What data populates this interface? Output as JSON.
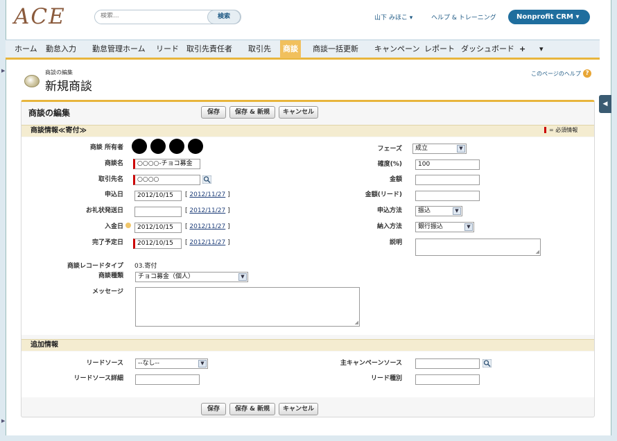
{
  "header": {
    "logo": "ACE",
    "search_placeholder": "検索...",
    "search_button": "検索",
    "user_menu": "山下 みほこ ▾",
    "help": "ヘルプ & トレーニング",
    "app_menu": "Nonprofit CRM ▾"
  },
  "tabs": [
    "ホーム",
    "勤怠入力",
    "勤怠管理ホーム",
    "リード",
    "取引先責任者",
    "取引先",
    "商談",
    "商談一括更新",
    "キャンペーン",
    "レポート",
    "ダッシュボード",
    "+",
    "▾"
  ],
  "active_tab": "商談",
  "page": {
    "subtitle": "商談の編集",
    "title": "新規商談",
    "help_link": "このページのヘルプ",
    "help_icon": "?"
  },
  "panel": {
    "title": "商談の編集",
    "save": "保存",
    "save_new": "保存 & 新規",
    "cancel": "キャンセル"
  },
  "section1": {
    "title": "商談情報≪寄付≫",
    "required_legend": "= 必須情報"
  },
  "left_fields": {
    "owner_label": "商談 所有者",
    "name_label": "商談名",
    "name_value": "○○○○-チョコ募金",
    "account_label": "取引先名",
    "account_value": "○○○○",
    "apply_date_label": "申込日",
    "apply_date_value": "2012/10/15",
    "thanks_label": "お礼状発送日",
    "thanks_value": "",
    "payment_date_label": "入金日",
    "payment_date_value": "2012/10/15",
    "close_date_label": "完了予定日",
    "close_date_value": "2012/10/15",
    "today_link": "2012/11/27",
    "record_type_label": "商談レコードタイプ",
    "record_type_value": "03.寄付",
    "kind_label": "商談種類",
    "kind_value": "チョコ募金（個人）",
    "message_label": "メッセージ"
  },
  "right_fields": {
    "phase_label": "フェーズ",
    "phase_value": "成立",
    "prob_label": "確度(%)",
    "prob_value": "100",
    "amount_label": "金額",
    "amount_value": "",
    "amount_lead_label": "金額(リード)",
    "amount_lead_value": "",
    "apply_method_label": "申込方法",
    "apply_method_value": "振込",
    "pay_method_label": "納入方法",
    "pay_method_value": "銀行振込",
    "description_label": "説明"
  },
  "section2": {
    "title": "追加情報",
    "lead_source_label": "リードソース",
    "lead_source_value": "--なし--",
    "lead_detail_label": "リードソース詳細",
    "campaign_label": "主キャンペーンソース",
    "lead_kind_label": "リード種別"
  }
}
